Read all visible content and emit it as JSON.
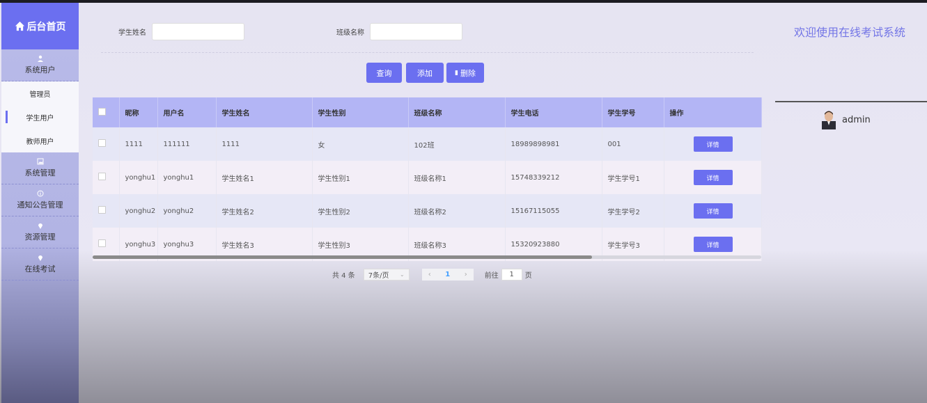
{
  "sidebar": {
    "brand": "后台首页",
    "groups": [
      {
        "label": "系统用户",
        "items": [
          "管理员",
          "学生用户",
          "教师用户"
        ]
      },
      {
        "label": "系统管理"
      },
      {
        "label": "通知公告管理"
      },
      {
        "label": "资源管理"
      },
      {
        "label": "在线考试"
      }
    ]
  },
  "search": {
    "student_name_label": "学生姓名",
    "class_name_label": "班级名称"
  },
  "buttons": {
    "query": "查询",
    "add": "添加",
    "delete": "删除"
  },
  "table": {
    "columns": [
      "昵称",
      "用户名",
      "学生姓名",
      "学生性别",
      "班级名称",
      "学生电话",
      "学生学号",
      "操作"
    ],
    "rows": [
      [
        "1111",
        "111111",
        "1111",
        "女",
        "102班",
        "18989898981",
        "001"
      ],
      [
        "yonghu1",
        "yonghu1",
        "学生姓名1",
        "学生性别1",
        "班级名称1",
        "15748339212",
        "学生学号1"
      ],
      [
        "yonghu2",
        "yonghu2",
        "学生姓名2",
        "学生性别2",
        "班级名称2",
        "15167115055",
        "学生学号2"
      ],
      [
        "yonghu3",
        "yonghu3",
        "学生姓名3",
        "学生性别3",
        "班级名称3",
        "15320923880",
        "学生学号3"
      ]
    ],
    "detail_label": "详情"
  },
  "pager": {
    "total": "共 4 条",
    "page_size": "7条/页",
    "current_page": "1",
    "goto_prefix": "前往",
    "goto_value": "1",
    "goto_suffix": "页"
  },
  "header": {
    "welcome": "欢迎使用在线考试系统",
    "username": "admin"
  },
  "colors": {
    "accent": "#6b6ff0",
    "header_row": "#b3b5f5"
  }
}
